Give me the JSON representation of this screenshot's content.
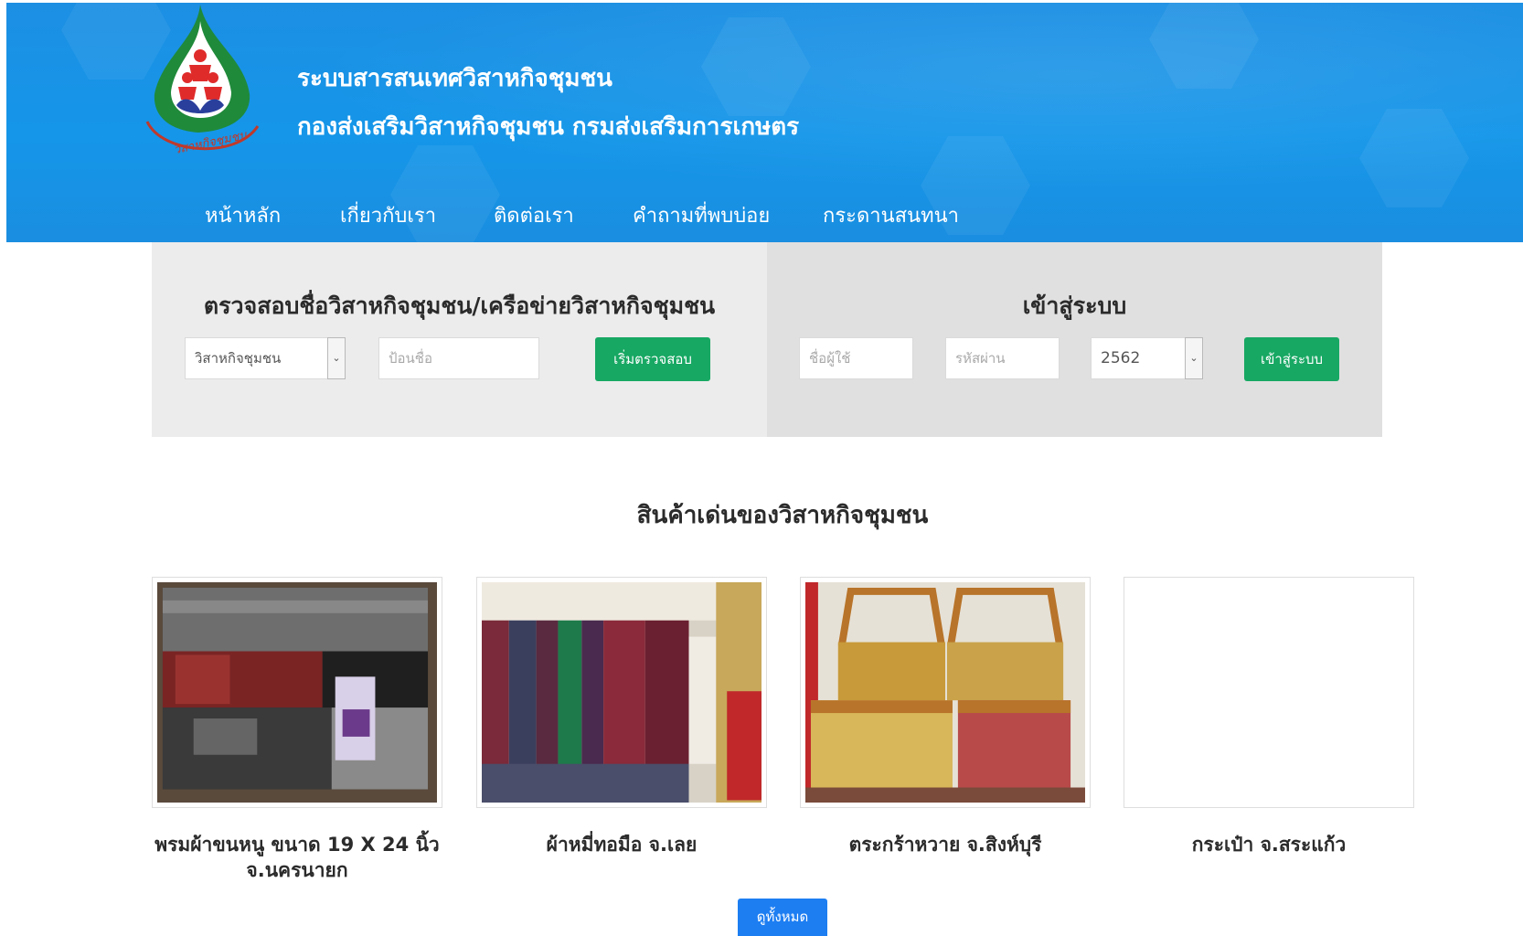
{
  "header": {
    "title_line1": "ระบบสารสนเทศวิสาหกิจชุมชน",
    "title_line2": "กองส่งเสริมวิสาหกิจชุมชน กรมส่งเสริมการเกษตร",
    "logo_text": "วิสาหกิจชุมชน"
  },
  "nav": {
    "items": [
      {
        "label": "หน้าหลัก"
      },
      {
        "label": "เกี่ยวกับเรา"
      },
      {
        "label": "ติดต่อเรา"
      },
      {
        "label": "คำถามที่พบบ่อย"
      },
      {
        "label": "กระดานสนทนา"
      }
    ]
  },
  "check_panel": {
    "title": "ตรวจสอบชื่อวิสาหกิจชุมชน/เครือข่ายวิสาหกิจชุมชน",
    "type_select_value": "วิสาหกิจชุมชน",
    "name_placeholder": "ป้อนชื่อ",
    "button_label": "เริ่มตรวจสอบ"
  },
  "login_panel": {
    "title": "เข้าสู่ระบบ",
    "username_placeholder": "ชื่อผู้ใช้",
    "password_placeholder": "รหัสผ่าน",
    "year_select_value": "2562",
    "button_label": "เข้าสู่ระบบ"
  },
  "products": {
    "section_title": "สินค้าเด่นของวิสาหกิจชุมชน",
    "items": [
      {
        "caption_line1": "พรมผ้าขนหนู ขนาด 19 X 24 นิ้ว",
        "caption_line2": "จ.นครนายก"
      },
      {
        "caption_line1": "ผ้าหมี่ทอมือ จ.เลย",
        "caption_line2": ""
      },
      {
        "caption_line1": "ตระกร้าหวาย จ.สิงห์บุรี",
        "caption_line2": ""
      },
      {
        "caption_line1": "กระเป๋า จ.สระแก้ว",
        "caption_line2": ""
      }
    ],
    "view_all_label": "ดูทั้งหมด"
  },
  "colors": {
    "banner_blue": "#1596e9",
    "green_button": "#17a863",
    "blue_button": "#1d7ef2"
  }
}
